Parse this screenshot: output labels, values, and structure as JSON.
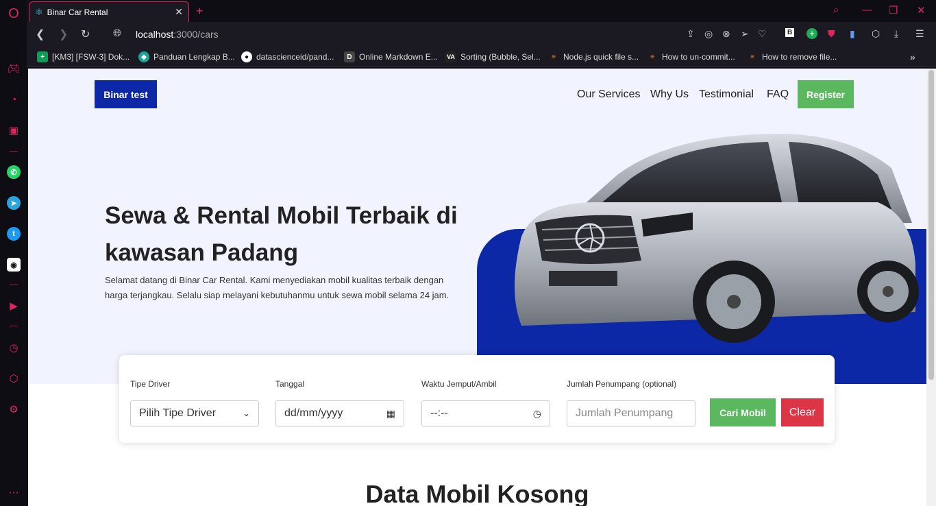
{
  "browser": {
    "tab_title": "Binar Car Rental",
    "url_host": "localhost",
    "url_rest": ":3000/cars",
    "bookmarks": [
      {
        "label": "[KM3] [FSW-3] Dok...",
        "icon": "sheets-icon",
        "color": "#0f9d58"
      },
      {
        "label": "Panduan Lengkap B...",
        "icon": "circle-icon",
        "color": "#1aa39a"
      },
      {
        "label": "datascienceid/pand...",
        "icon": "github-icon",
        "color": "#333333"
      },
      {
        "label": "Online Markdown E...",
        "icon": "d-icon",
        "color": "#444444"
      },
      {
        "label": "Sorting (Bubble, Sel...",
        "icon": "visualgo-icon",
        "color": "#222222"
      },
      {
        "label": "Node.js quick file s...",
        "icon": "stackoverflow-icon",
        "color": "#f48024"
      },
      {
        "label": "How to un-commit...",
        "icon": "stackoverflow-icon",
        "color": "#f48024"
      },
      {
        "label": "How to remove file...",
        "icon": "stackoverflow-icon",
        "color": "#f48024"
      }
    ]
  },
  "nav": {
    "brand": "Binar test",
    "links": [
      "Our Services",
      "Why Us",
      "Testimonial",
      "FAQ"
    ],
    "register": "Register"
  },
  "hero": {
    "title": "Sewa & Rental Mobil Terbaik di kawasan Padang",
    "subtitle": "Selamat datang di Binar Car Rental. Kami menyediakan mobil kualitas terbaik dengan harga terjangkau. Selalu siap melayani kebutuhanmu untuk sewa mobil selama 24 jam."
  },
  "search": {
    "driver_label": "Tipe Driver",
    "driver_value": "Pilih Tipe Driver",
    "date_label": "Tanggal",
    "date_value": "dd/mm/yyyy",
    "time_label": "Waktu Jemput/Ambil",
    "time_value": "--:--",
    "passenger_label": "Jumlah Penumpang (optional)",
    "passenger_placeholder": "Jumlah Penumpang",
    "submit": "Cari Mobil",
    "clear": "Clear"
  },
  "section_title": "Data Mobil Kosong",
  "colors": {
    "brand_blue": "#0d28a6",
    "success_green": "#5cb85f",
    "danger_red": "#dc3545",
    "opera_accent": "#e0245e"
  }
}
